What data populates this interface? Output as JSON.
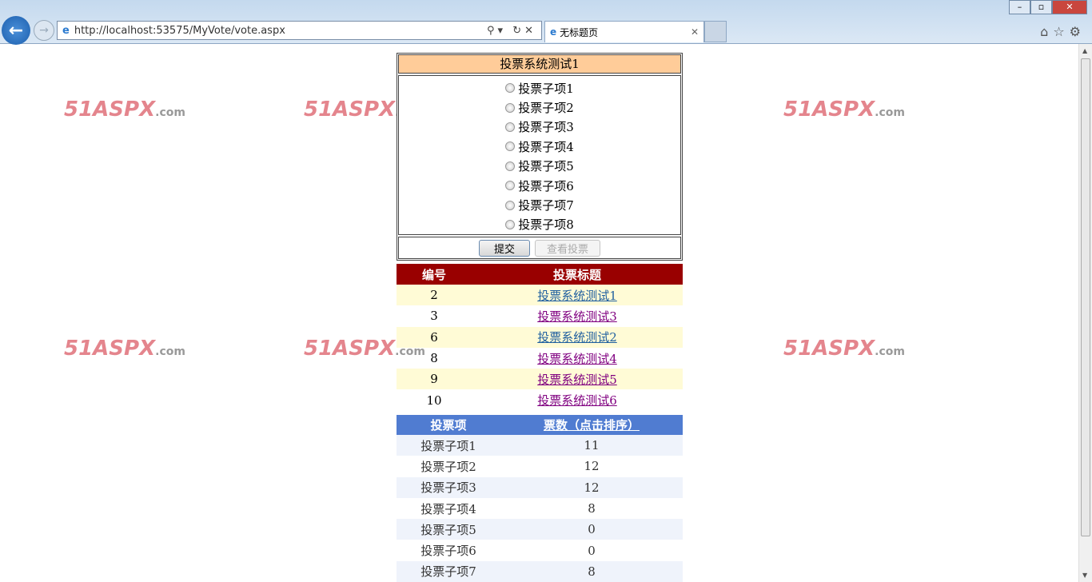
{
  "browser": {
    "url": "http://localhost:53575/MyVote/vote.aspx",
    "url_host": "localhost",
    "tab_title": "无标题页"
  },
  "watermark": "51ASPX",
  "watermark_suffix": ".com",
  "vote": {
    "title": "投票系统测试1",
    "options": [
      "投票子项1",
      "投票子项2",
      "投票子项3",
      "投票子项4",
      "投票子项5",
      "投票子项6",
      "投票子项7",
      "投票子项8"
    ],
    "submit_label": "提交",
    "view_label": "查看投票"
  },
  "polls": {
    "headers": [
      "编号",
      "投票标题"
    ],
    "rows": [
      {
        "id": "2",
        "title": "投票系统测试1"
      },
      {
        "id": "3",
        "title": "投票系统测试3"
      },
      {
        "id": "6",
        "title": "投票系统测试2"
      },
      {
        "id": "8",
        "title": "投票系统测试4"
      },
      {
        "id": "9",
        "title": "投票系统测试5"
      },
      {
        "id": "10",
        "title": "投票系统测试6"
      }
    ]
  },
  "results": {
    "headers": [
      "投票项",
      "票数（点击排序）"
    ],
    "rows": [
      {
        "item": "投票子项1",
        "count": "11"
      },
      {
        "item": "投票子项2",
        "count": "12"
      },
      {
        "item": "投票子项3",
        "count": "12"
      },
      {
        "item": "投票子项4",
        "count": "8"
      },
      {
        "item": "投票子项5",
        "count": "0"
      },
      {
        "item": "投票子项6",
        "count": "0"
      },
      {
        "item": "投票子项7",
        "count": "8"
      }
    ]
  }
}
